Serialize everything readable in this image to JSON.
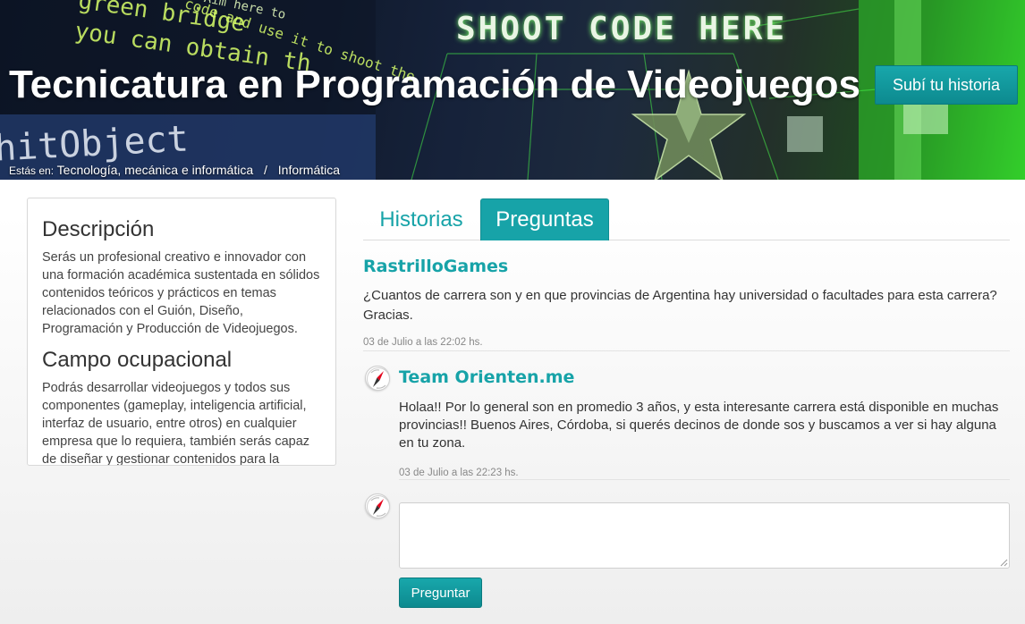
{
  "hero": {
    "title": "Tecnicatura en Programación de Videojuegos",
    "cta_label": "Subí tu historia",
    "bg_text": {
      "line1": "green bridge",
      "line2": "you can obtain th",
      "line3": "code and use it to shoot the",
      "small": "Aim here to",
      "big_blue": "hitObject",
      "shoot": "SHOOT CODE HERE"
    },
    "breadcrumb": {
      "prefix": "Estás en:",
      "items": [
        "Tecnología, mecánica e informática",
        "Informática"
      ],
      "separator": "/"
    }
  },
  "description": {
    "heading1": "Descripción",
    "text1": "Serás un profesional creativo e innovador con una formación académica sustentada en sólidos contenidos teóricos y prácticos en temas relacionados con el Guión, Diseño, Programación y Producción de Videojuegos.",
    "heading2": "Campo ocupacional",
    "text2": "Podrás desarrollar videojuegos y todos sus componentes (gameplay, inteligencia artificial, interfaz de usuario, entre otros) en cualquier empresa que lo requiera, también serás capaz de diseñar y gestionar contenidos para la industria del entretenimiento digital."
  },
  "tabs": [
    {
      "label": "Historias",
      "active": false
    },
    {
      "label": "Preguntas",
      "active": true
    }
  ],
  "question": {
    "author": "RastrilloGames",
    "text": "¿Cuantos de carrera son y en que provincias de Argentina hay universidad o facultades para esta carrera? Gracias.",
    "date": "03 de Julio a las 22:02 hs."
  },
  "answer": {
    "author": "Team Orienten.me",
    "text": "Holaa!! Por lo general son en promedio 3 años, y esta interesante carrera está disponible en muchas provincias!! Buenos Aires, Córdoba, si querés decinos de donde sos y buscamos a ver si hay alguna en tu zona.",
    "date": "03 de Julio a las 22:23 hs.",
    "avatar_icon": "compass-logo-icon"
  },
  "reply": {
    "placeholder": "",
    "button_label": "Preguntar",
    "avatar_icon": "compass-logo-icon"
  },
  "colors": {
    "accent": "#17a3a8",
    "compass_red": "#e3001b"
  }
}
